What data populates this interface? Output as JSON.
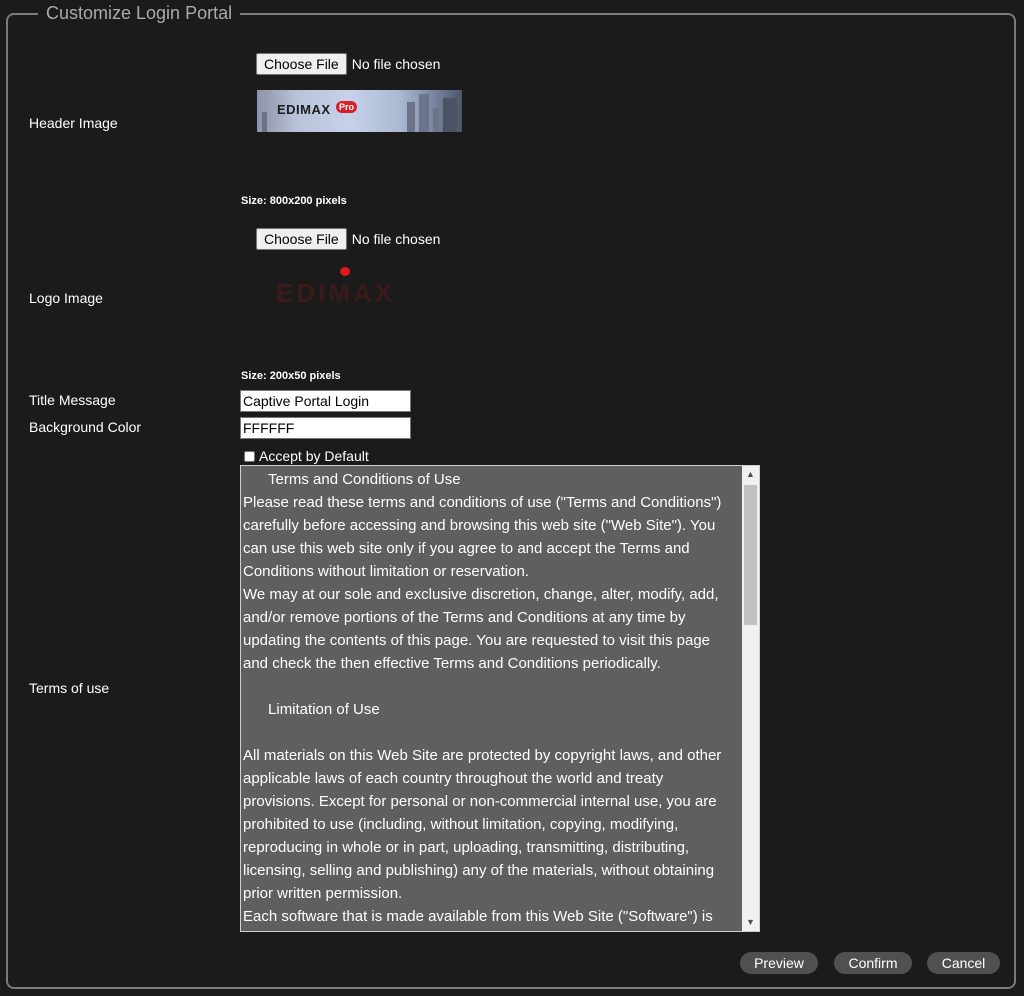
{
  "panel": {
    "title": "Customize Login Portal"
  },
  "header_image": {
    "label": "Header Image",
    "choose_button": "Choose File",
    "file_status": "No file chosen",
    "preview_brand": "EDIMAX",
    "preview_badge": "Pro",
    "size_note": "Size: 800x200 pixels"
  },
  "logo_image": {
    "label": "Logo Image",
    "choose_button": "Choose File",
    "file_status": "No file chosen",
    "preview_text": "EDIMAX",
    "size_note": "Size: 200x50 pixels"
  },
  "title_message": {
    "label": "Title Message",
    "value": "Captive Portal Login"
  },
  "background_color": {
    "label": "Background Color",
    "value": "FFFFFF"
  },
  "accept_by_default": {
    "label": "Accept by Default",
    "checked": false
  },
  "terms_of_use": {
    "label": "Terms of use",
    "text": "      Terms and Conditions of Use\nPlease read these terms and conditions of use (\"Terms and Conditions\") carefully before accessing and browsing this web site (\"Web Site\"). You can use this web site only if you agree to and accept the Terms and Conditions without limitation or reservation.\nWe may at our sole and exclusive discretion, change, alter, modify, add, and/or remove portions of the Terms and Conditions at any time by updating the contents of this page. You are requested to visit this page and check the then effective Terms and Conditions periodically.\n\n      Limitation of Use\n\nAll materials on this Web Site are protected by copyright laws, and other applicable laws of each country throughout the world and treaty provisions. Except for personal or non-commercial internal use, you are prohibited to use (including, without limitation, copying, modifying, reproducing in whole or in part, uploading, transmitting, distributing, licensing, selling and publishing) any of the materials, without obtaining prior written permission.\nEach software that is made available from this Web Site (\"Software\") is"
  },
  "buttons": {
    "preview": "Preview",
    "confirm": "Confirm",
    "cancel": "Cancel"
  }
}
